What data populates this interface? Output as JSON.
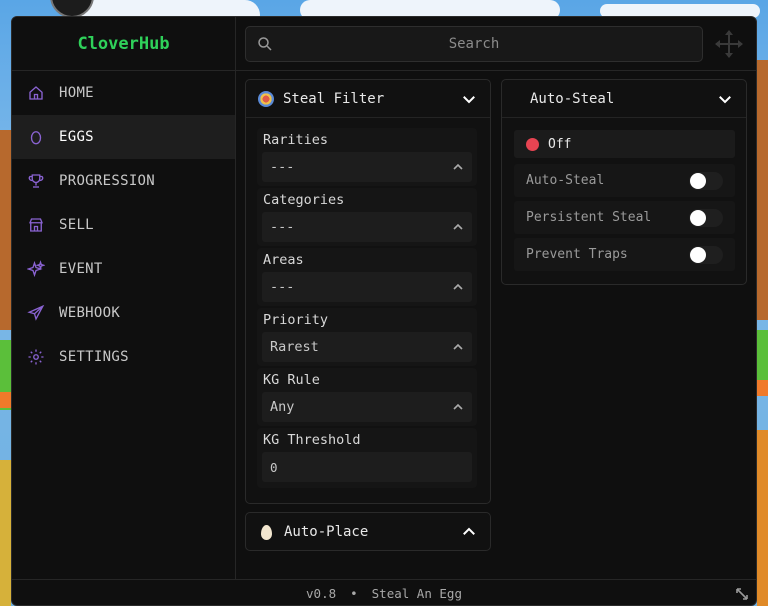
{
  "app": {
    "brand": "CloverHub"
  },
  "nav": {
    "items": [
      {
        "label": "HOME",
        "icon": "home-icon",
        "active": false
      },
      {
        "label": "EGGS",
        "icon": "egg-icon",
        "active": true
      },
      {
        "label": "PROGRESSION",
        "icon": "trophy-icon",
        "active": false
      },
      {
        "label": "SELL",
        "icon": "store-icon",
        "active": false
      },
      {
        "label": "EVENT",
        "icon": "sparkles-icon",
        "active": false
      },
      {
        "label": "WEBHOOK",
        "icon": "send-icon",
        "active": false
      },
      {
        "label": "SETTINGS",
        "icon": "gear-icon",
        "active": false
      }
    ]
  },
  "search": {
    "placeholder": "Search"
  },
  "steal_filter": {
    "title": "Steal Filter",
    "fields": [
      {
        "label": "Rarities",
        "value": "---"
      },
      {
        "label": "Categories",
        "value": "---"
      },
      {
        "label": "Areas",
        "value": "---"
      },
      {
        "label": "Priority",
        "value": "Rarest"
      },
      {
        "label": "KG Rule",
        "value": "Any"
      }
    ],
    "threshold": {
      "label": "KG Threshold",
      "value": "0"
    }
  },
  "auto_place": {
    "title": "Auto-Place"
  },
  "auto_steal": {
    "title": "Auto-Steal",
    "status": "Off",
    "toggles": [
      {
        "label": "Auto-Steal",
        "on": false
      },
      {
        "label": "Persistent Steal",
        "on": false
      },
      {
        "label": "Prevent Traps",
        "on": false
      }
    ]
  },
  "footer": {
    "version": "v0.8",
    "separator": "•",
    "game": "Steal An Egg"
  },
  "colors": {
    "accent": "#8a63d2",
    "brand": "#2fd15a",
    "status_off": "#e64452"
  }
}
